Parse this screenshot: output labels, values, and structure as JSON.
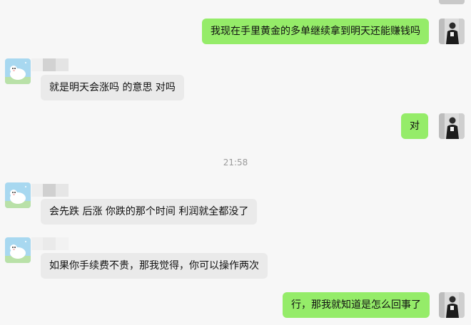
{
  "chat": {
    "messages": [
      {
        "sender": "self",
        "text": "我现在手里黄金的多单继续拿到明天还能赚钱吗"
      },
      {
        "sender": "other",
        "text": "就是明天会涨吗 的意思 对吗"
      },
      {
        "sender": "self",
        "text": "对"
      },
      {
        "sender": "other",
        "text": "会先跌 后涨 你跌的那个时间 利润就全都没了"
      },
      {
        "sender": "other",
        "text": "如果你手续费不贵，那我觉得，你可以操作两次"
      },
      {
        "sender": "self",
        "text": "行，那我就知道是怎么回事了"
      }
    ],
    "timestamp": "21:58"
  },
  "avatars": {
    "self_icon": "person-photo-icon",
    "other_icon": "cartoon-sheep-icon"
  },
  "colors": {
    "self_bubble": "#95ec69",
    "other_bubble": "#eaeaea",
    "background": "#f7f7f7",
    "timestamp_text": "#9a9a9a"
  }
}
